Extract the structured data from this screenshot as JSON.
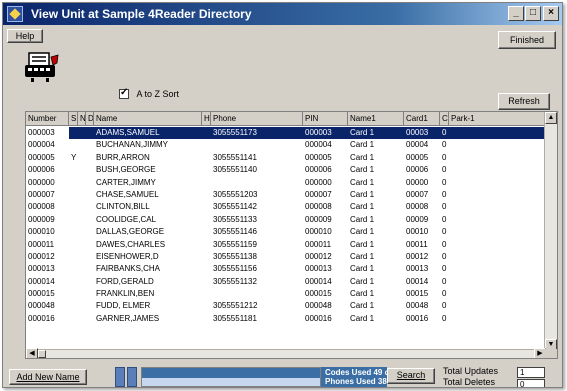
{
  "window": {
    "title": "View Unit at Sample 4Reader Directory",
    "controls": {
      "minimize": "_",
      "maximize": "□",
      "close": "×"
    }
  },
  "toolbar": {
    "help_label": "Help",
    "finished_label": "Finished",
    "refresh_label": "Refresh"
  },
  "sort": {
    "label": "A to Z  Sort",
    "checked": true
  },
  "table": {
    "columns": [
      "Number",
      "S",
      "N",
      "D",
      "Name",
      "H",
      "Phone",
      "PIN",
      "Name1",
      "Card1",
      "C",
      "Park-1"
    ],
    "rows": [
      {
        "number": "000003",
        "s": "",
        "name": "ADAMS,SAMUEL",
        "phone": "3055551173",
        "pin": "000003",
        "name1": "Card 1",
        "card1": "00003",
        "c": "0"
      },
      {
        "number": "000004",
        "s": "",
        "name": "BUCHANAN,JIMMY",
        "phone": "",
        "pin": "000004",
        "name1": "Card 1",
        "card1": "00004",
        "c": "0"
      },
      {
        "number": "000005",
        "s": "Y",
        "name": "BURR,ARRON",
        "phone": "3055551141",
        "pin": "000005",
        "name1": "Card 1",
        "card1": "00005",
        "c": "0"
      },
      {
        "number": "000006",
        "s": "",
        "name": "BUSH,GEORGE",
        "phone": "3055551140",
        "pin": "000006",
        "name1": "Card 1",
        "card1": "00006",
        "c": "0"
      },
      {
        "number": "000000",
        "s": "",
        "name": "CARTER,JIMMY",
        "phone": "",
        "pin": "000000",
        "name1": "Card 1",
        "card1": "00000",
        "c": "0"
      },
      {
        "number": "000007",
        "s": "",
        "name": "CHASE,SAMUEL",
        "phone": "3055551203",
        "pin": "000007",
        "name1": "Card 1",
        "card1": "00007",
        "c": "0"
      },
      {
        "number": "000008",
        "s": "",
        "name": "CLINTON,BILL",
        "phone": "3055551142",
        "pin": "000008",
        "name1": "Card 1",
        "card1": "00008",
        "c": "0"
      },
      {
        "number": "000009",
        "s": "",
        "name": "COOLIDGE,CAL",
        "phone": "3055551133",
        "pin": "000009",
        "name1": "Card 1",
        "card1": "00009",
        "c": "0"
      },
      {
        "number": "000010",
        "s": "",
        "name": "DALLAS,GEORGE",
        "phone": "3055551146",
        "pin": "000010",
        "name1": "Card 1",
        "card1": "00010",
        "c": "0"
      },
      {
        "number": "000011",
        "s": "",
        "name": "DAWES,CHARLES",
        "phone": "3055551159",
        "pin": "000011",
        "name1": "Card 1",
        "card1": "00011",
        "c": "0"
      },
      {
        "number": "000012",
        "s": "",
        "name": "EISENHOWER,D",
        "phone": "3055551138",
        "pin": "000012",
        "name1": "Card 1",
        "card1": "00012",
        "c": "0"
      },
      {
        "number": "000013",
        "s": "",
        "name": "FAIRBANKS,CHA",
        "phone": "3055551156",
        "pin": "000013",
        "name1": "Card 1",
        "card1": "00013",
        "c": "0"
      },
      {
        "number": "000014",
        "s": "",
        "name": "FORD,GERALD",
        "phone": "3055551132",
        "pin": "000014",
        "name1": "Card 1",
        "card1": "00014",
        "c": "0"
      },
      {
        "number": "000015",
        "s": "",
        "name": "FRANKLIN,BEN",
        "phone": "",
        "pin": "000015",
        "name1": "Card 1",
        "card1": "00015",
        "c": "0"
      },
      {
        "number": "000048",
        "s": "",
        "name": "FUDD, ELMER",
        "phone": "3055551212",
        "pin": "000048",
        "name1": "Card 1",
        "card1": "00048",
        "c": "0"
      },
      {
        "number": "000016",
        "s": "",
        "name": "GARNER,JAMES",
        "phone": "3055551181",
        "pin": "000016",
        "name1": "Card 1",
        "card1": "00016",
        "c": "0"
      }
    ],
    "selected_index": 0
  },
  "footer": {
    "add_label": "Add New Name",
    "codes_used": "Codes  Used 49 of 510",
    "phones_used": "Phones Used 38 of 500",
    "search_label": "Search",
    "total_updates_label": "Total Updates",
    "total_updates_value": "1",
    "total_deletes_label": "Total Deletes",
    "total_deletes_value": "0"
  },
  "colors": {
    "title_bar": "#0a246a",
    "selection": "#0a246a",
    "face": "#d4d0c8"
  },
  "icons": [
    "app-icon",
    "phone-logo-icon",
    "scroll-up-icon",
    "scroll-down-icon",
    "scroll-left-icon",
    "scroll-right-icon"
  ]
}
